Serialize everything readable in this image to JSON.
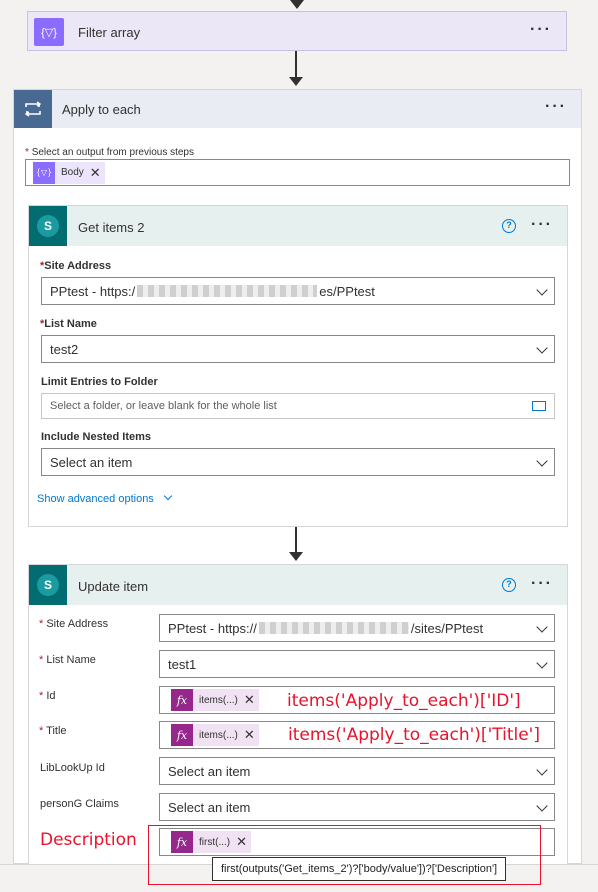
{
  "filter_array": {
    "title": "Filter array",
    "more": "···"
  },
  "apply_each": {
    "title": "Apply to each",
    "more": "···",
    "select_label": "Select an output from previous steps",
    "token_body": "Body"
  },
  "get_items": {
    "title": "Get items 2",
    "help": "?",
    "more": "···",
    "site_label": "Site Address",
    "site_value_a": "PPtest - https:/",
    "site_value_b": "es/PPtest",
    "list_label": "List Name",
    "list_value": "test2",
    "folder_label": "Limit Entries to Folder",
    "folder_placeholder": "Select a folder, or leave blank for the whole list",
    "nested_label": "Include Nested Items",
    "nested_value": "Select an item",
    "advanced": "Show advanced options"
  },
  "update_item": {
    "title": "Update item",
    "help": "?",
    "more": "···",
    "site_label": "Site Address",
    "site_value_a": "PPtest - https://",
    "site_value_b": "/sites/PPtest",
    "list_label": "List Name",
    "list_value": "test1",
    "id_label": "Id",
    "id_token": "items(...)",
    "title_label": "Title",
    "title_token": "items(...)",
    "lib_label": "LibLookUp Id",
    "lib_value": "Select an item",
    "person_label": "personG Claims",
    "person_value": "Select an item",
    "desc_token": "first(...)",
    "tooltip": "first(outputs('Get_items_2')?['body/value'])?['Description']"
  },
  "annotations": {
    "id": "items('Apply_to_each')['ID']",
    "title": "items('Apply_to_each')['Title']",
    "desc": "Description"
  }
}
